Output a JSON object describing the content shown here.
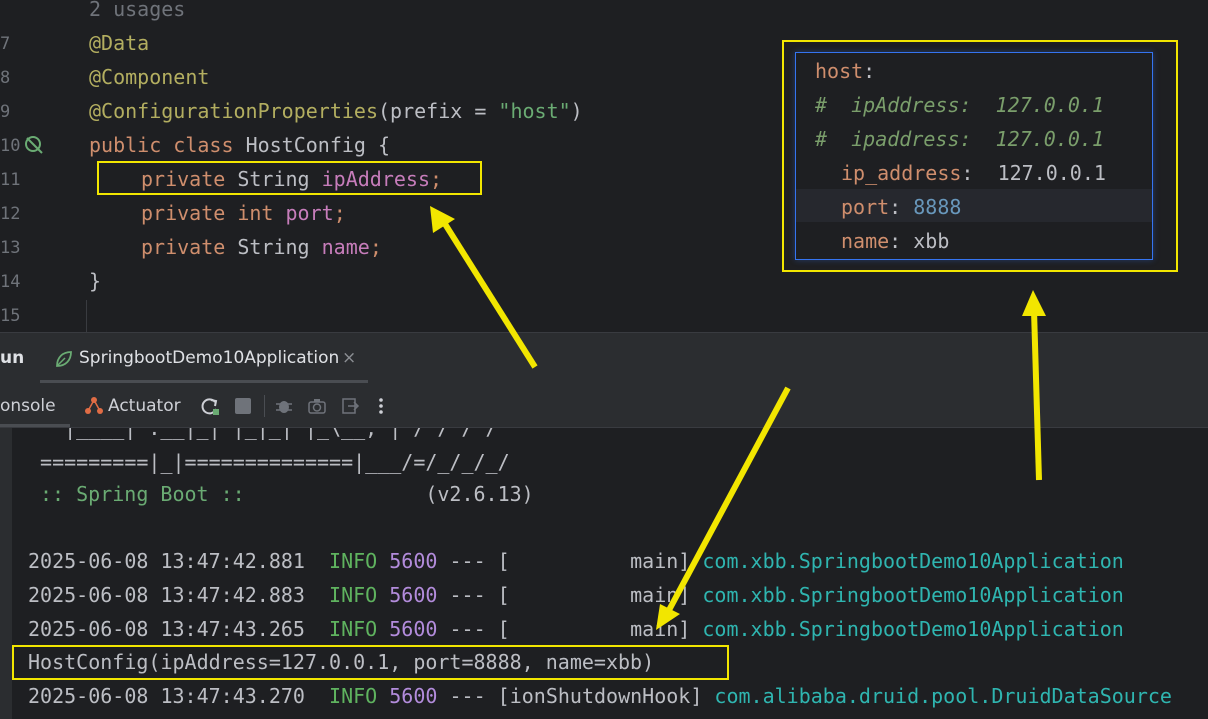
{
  "editor": {
    "usages": "2 usages",
    "line_numbers": [
      "7",
      "8",
      "9",
      "10",
      "11",
      "12",
      "13",
      "14",
      "15"
    ],
    "code": {
      "ann_data": "@Data",
      "ann_component": "@Component",
      "ann_config": "@ConfigurationProperties",
      "config_open": "(prefix = ",
      "config_prefix": "\"host\"",
      "config_close": ")",
      "kw_public": "public",
      "kw_class": "class",
      "class_name": "HostConfig",
      "brace_open": "{",
      "kw_private": "private",
      "type_string": "String",
      "kw_int": "int",
      "field_ip": "ipAddress",
      "field_port": "port",
      "field_name": "name",
      "semicolon": ";",
      "brace_close": "}"
    }
  },
  "yaml": {
    "root_key": "host",
    "colon": ":",
    "comment1_hash": "#",
    "comment1": "ipAddress:  127.0.0.1",
    "comment2_hash": "#",
    "comment2": "ipaddress:  127.0.0.1",
    "ip_key": "ip_address",
    "ip_value": "127.0.0.1",
    "port_key": "port",
    "port_value": "8888",
    "name_key": "name",
    "name_value": "xbb"
  },
  "run": {
    "panel_label": "un",
    "tab_title": "SpringbootDemo10Application",
    "close_glyph": "×",
    "console_tab": "onsole",
    "actuator_tab": "Actuator"
  },
  "console": {
    "banner1": "  |____| .__|_| |_|_| |_\\__, | / / / /",
    "banner2": " =========|_|==============|___/=/_/_/_/",
    "spring_boot": ":: Spring Boot ::",
    "version": "(v2.6.13)",
    "logs": [
      {
        "ts": "2025-06-08 13:47:42.881",
        "level": "INFO",
        "pid": "5600",
        "sep": "--- [",
        "thread": "main]",
        "cls": "com.xbb.SpringbootDemo10Application"
      },
      {
        "ts": "2025-06-08 13:47:42.883",
        "level": "INFO",
        "pid": "5600",
        "sep": "--- [",
        "thread": "main]",
        "cls": "com.xbb.SpringbootDemo10Application"
      },
      {
        "ts": "2025-06-08 13:47:43.265",
        "level": "INFO",
        "pid": "5600",
        "sep": "--- [",
        "thread": "main]",
        "cls": "com.xbb.SpringbootDemo10Application"
      }
    ],
    "output": "HostConfig(ipAddress=127.0.0.1, port=8888, name=xbb)",
    "last_log": {
      "ts": "2025-06-08 13:47:43.270",
      "level": "INFO",
      "pid": "5600",
      "sep": "--- [",
      "thread": "ionShutdownHook]",
      "cls": "com.alibaba.druid.pool.DruidDataSource"
    }
  },
  "colors": {
    "highlight": "#f2e600",
    "background": "#1e1f22",
    "keyword": "#cf8e6d",
    "annotation": "#b3ae60",
    "string": "#6aab73",
    "field": "#c77dbb"
  },
  "icons": [
    "spring-leaf-icon",
    "close-icon",
    "actuator-icon",
    "rerun-icon",
    "stop-icon",
    "debug-icon",
    "camera-icon",
    "exit-icon",
    "more-vertical-icon",
    "bean-gutter-icon"
  ]
}
